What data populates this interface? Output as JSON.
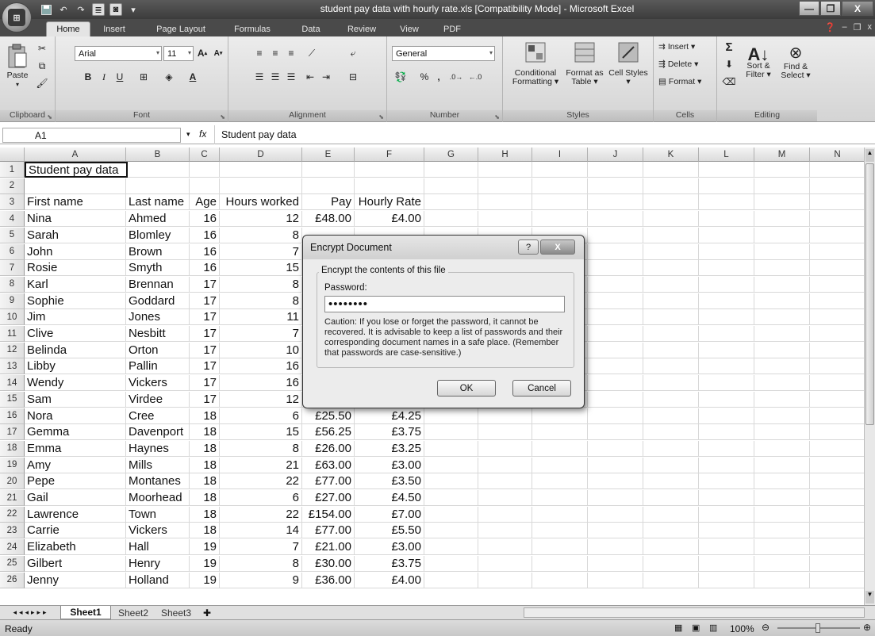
{
  "window": {
    "title": "student pay data with hourly rate.xls  [Compatibility Mode] - Microsoft Excel",
    "office_button": "Office",
    "minimize": "—",
    "maximize": "❐",
    "close": "X"
  },
  "ribbon_tabs": [
    "Home",
    "Insert",
    "Page Layout",
    "Formulas",
    "Data",
    "Review",
    "View",
    "PDF"
  ],
  "ribbon": {
    "clipboard": {
      "label": "Clipboard",
      "paste": "Paste"
    },
    "font": {
      "label": "Font",
      "name": "Arial",
      "size": "11",
      "bold": "B",
      "italic": "I",
      "underline": "U"
    },
    "alignment": {
      "label": "Alignment"
    },
    "number": {
      "label": "Number",
      "format": "General",
      "percent": "%",
      "comma": ","
    },
    "styles": {
      "label": "Styles",
      "conditional": "Conditional Formatting ▾",
      "format_table": "Format as Table ▾",
      "cell_styles": "Cell Styles ▾"
    },
    "cells": {
      "label": "Cells",
      "insert": "Insert ▾",
      "delete": "Delete ▾",
      "format": "Format ▾"
    },
    "editing": {
      "label": "Editing",
      "sort": "Sort & Filter ▾",
      "find": "Find & Select ▾"
    }
  },
  "formula_bar": {
    "name_box": "A1",
    "fx": "fx",
    "content": "Student pay data"
  },
  "columns": [
    "A",
    "B",
    "C",
    "D",
    "E",
    "F",
    "G",
    "H",
    "I",
    "J",
    "K",
    "L",
    "M",
    "N"
  ],
  "rows": [
    {
      "n": "1",
      "a": "Student pay data",
      "b": "",
      "c": "",
      "d": "",
      "e": "",
      "f": ""
    },
    {
      "n": "2",
      "a": "",
      "b": "",
      "c": "",
      "d": "",
      "e": "",
      "f": ""
    },
    {
      "n": "3",
      "a": "First name",
      "b": "Last name",
      "c": "Age",
      "d": "Hours worked",
      "e": "Pay",
      "f": "Hourly Rate"
    },
    {
      "n": "4",
      "a": "Nina",
      "b": "Ahmed",
      "c": "16",
      "d": "12",
      "e": "£48.00",
      "f": "£4.00"
    },
    {
      "n": "5",
      "a": "Sarah",
      "b": "Blomley",
      "c": "16",
      "d": "8",
      "e": "",
      "f": ""
    },
    {
      "n": "6",
      "a": "John",
      "b": "Brown",
      "c": "16",
      "d": "7",
      "e": "",
      "f": ""
    },
    {
      "n": "7",
      "a": "Rosie",
      "b": "Smyth",
      "c": "16",
      "d": "15",
      "e": "",
      "f": ""
    },
    {
      "n": "8",
      "a": "Karl",
      "b": "Brennan",
      "c": "17",
      "d": "8",
      "e": "",
      "f": ""
    },
    {
      "n": "9",
      "a": "Sophie",
      "b": "Goddard",
      "c": "17",
      "d": "8",
      "e": "",
      "f": ""
    },
    {
      "n": "10",
      "a": "Jim",
      "b": "Jones",
      "c": "17",
      "d": "11",
      "e": "",
      "f": ""
    },
    {
      "n": "11",
      "a": "Clive",
      "b": "Nesbitt",
      "c": "17",
      "d": "7",
      "e": "",
      "f": ""
    },
    {
      "n": "12",
      "a": "Belinda",
      "b": "Orton",
      "c": "17",
      "d": "10",
      "e": "",
      "f": ""
    },
    {
      "n": "13",
      "a": "Libby",
      "b": "Pallin",
      "c": "17",
      "d": "16",
      "e": "",
      "f": ""
    },
    {
      "n": "14",
      "a": "Wendy",
      "b": "Vickers",
      "c": "17",
      "d": "16",
      "e": "",
      "f": ""
    },
    {
      "n": "15",
      "a": "Sam",
      "b": "Virdee",
      "c": "17",
      "d": "12",
      "e": "£48.00",
      "f": "£4.00"
    },
    {
      "n": "16",
      "a": "Nora",
      "b": "Cree",
      "c": "18",
      "d": "6",
      "e": "£25.50",
      "f": "£4.25"
    },
    {
      "n": "17",
      "a": "Gemma",
      "b": "Davenport",
      "c": "18",
      "d": "15",
      "e": "£56.25",
      "f": "£3.75"
    },
    {
      "n": "18",
      "a": "Emma",
      "b": "Haynes",
      "c": "18",
      "d": "8",
      "e": "£26.00",
      "f": "£3.25"
    },
    {
      "n": "19",
      "a": "Amy",
      "b": "Mills",
      "c": "18",
      "d": "21",
      "e": "£63.00",
      "f": "£3.00"
    },
    {
      "n": "20",
      "a": "Pepe",
      "b": "Montanes",
      "c": "18",
      "d": "22",
      "e": "£77.00",
      "f": "£3.50"
    },
    {
      "n": "21",
      "a": "Gail",
      "b": "Moorhead",
      "c": "18",
      "d": "6",
      "e": "£27.00",
      "f": "£4.50"
    },
    {
      "n": "22",
      "a": "Lawrence",
      "b": "Town",
      "c": "18",
      "d": "22",
      "e": "£154.00",
      "f": "£7.00"
    },
    {
      "n": "23",
      "a": "Carrie",
      "b": "Vickers",
      "c": "18",
      "d": "14",
      "e": "£77.00",
      "f": "£5.50"
    },
    {
      "n": "24",
      "a": "Elizabeth",
      "b": "Hall",
      "c": "19",
      "d": "7",
      "e": "£21.00",
      "f": "£3.00"
    },
    {
      "n": "25",
      "a": "Gilbert",
      "b": "Henry",
      "c": "19",
      "d": "8",
      "e": "£30.00",
      "f": "£3.75"
    },
    {
      "n": "26",
      "a": "Jenny",
      "b": "Holland",
      "c": "19",
      "d": "9",
      "e": "£36.00",
      "f": "£4.00"
    }
  ],
  "sheets": [
    "Sheet1",
    "Sheet2",
    "Sheet3"
  ],
  "status": {
    "text": "Ready",
    "zoom": "100%"
  },
  "dialog": {
    "title": "Encrypt Document",
    "help": "?",
    "close": "X",
    "group": "Encrypt the contents of this file",
    "password_label": "Password:",
    "password_value": "••••••••",
    "caution": "Caution: If you lose or forget the password, it cannot be recovered. It is advisable to keep a list of passwords and their corresponding document names in a safe place. (Remember that passwords are case-sensitive.)",
    "ok": "OK",
    "cancel": "Cancel"
  }
}
